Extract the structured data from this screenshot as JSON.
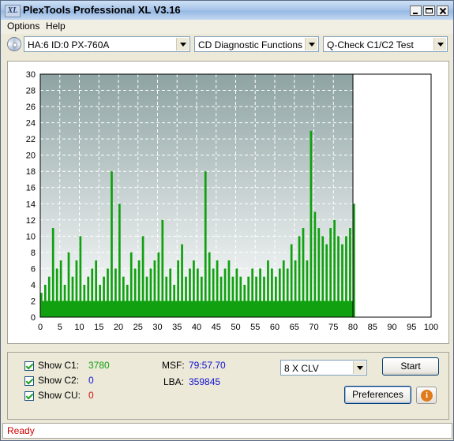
{
  "window": {
    "title": "PlexTools Professional XL V3.16",
    "app_icon_text": "XL"
  },
  "menu": [
    {
      "label": "Options"
    },
    {
      "label": "Help"
    }
  ],
  "toolbar": {
    "drive": "HA:6 ID:0  PX-760A",
    "function": "CD Diagnostic Functions",
    "test": "Q-Check C1/C2 Test"
  },
  "chart_data": {
    "type": "bar",
    "title": "",
    "xlabel": "",
    "ylabel": "",
    "xlim": [
      0,
      100
    ],
    "ylim": [
      0,
      30
    ],
    "x_ticks": [
      0,
      5,
      10,
      15,
      20,
      25,
      30,
      35,
      40,
      45,
      50,
      55,
      60,
      65,
      70,
      75,
      80,
      85,
      90,
      95,
      100
    ],
    "y_ticks": [
      0,
      2,
      4,
      6,
      8,
      10,
      12,
      14,
      16,
      18,
      20,
      22,
      24,
      26,
      28,
      30
    ],
    "grid": true,
    "test_end_x": 80,
    "series": [
      {
        "name": "C1",
        "color": "#10a010",
        "x": [
          0,
          1,
          2,
          3,
          4,
          5,
          6,
          7,
          8,
          9,
          10,
          11,
          12,
          13,
          14,
          15,
          16,
          17,
          18,
          19,
          20,
          21,
          22,
          23,
          24,
          25,
          26,
          27,
          28,
          29,
          30,
          31,
          32,
          33,
          34,
          35,
          36,
          37,
          38,
          39,
          40,
          41,
          42,
          43,
          44,
          45,
          46,
          47,
          48,
          49,
          50,
          51,
          52,
          53,
          54,
          55,
          56,
          57,
          58,
          59,
          60,
          61,
          62,
          63,
          64,
          65,
          66,
          67,
          68,
          69,
          70,
          71,
          72,
          73,
          74,
          75,
          76,
          77,
          78,
          79,
          80
        ],
        "values": [
          3,
          4,
          5,
          11,
          6,
          7,
          4,
          8,
          5,
          7,
          10,
          4,
          5,
          6,
          7,
          4,
          5,
          6,
          18,
          6,
          14,
          5,
          4,
          8,
          6,
          7,
          10,
          5,
          6,
          7,
          8,
          12,
          5,
          6,
          4,
          7,
          9,
          5,
          6,
          7,
          6,
          5,
          18,
          8,
          6,
          7,
          5,
          6,
          7,
          5,
          6,
          5,
          4,
          5,
          6,
          5,
          6,
          5,
          7,
          6,
          5,
          6,
          7,
          6,
          9,
          7,
          10,
          11,
          7,
          23,
          13,
          11,
          10,
          9,
          11,
          12,
          10,
          9,
          10,
          11,
          14
        ]
      }
    ]
  },
  "stats": {
    "show_c1_label": "Show C1:",
    "c1_value": "3780",
    "show_c2_label": "Show C2:",
    "c2_value": "0",
    "show_cu_label": "Show CU:",
    "cu_value": "0",
    "msf_label": "MSF:",
    "msf_value": "79:57.70",
    "lba_label": "LBA:",
    "lba_value": "359845"
  },
  "controls": {
    "speed": "8 X CLV",
    "start_label": "Start",
    "preferences_label": "Preferences",
    "info_icon": "i"
  },
  "status": {
    "text": "Ready"
  },
  "colors": {
    "c1_value": "#10a010",
    "c2_value": "#1010d0",
    "cu_value": "#d01010",
    "msf_value": "#1010d0",
    "status_text": "#d40000"
  }
}
